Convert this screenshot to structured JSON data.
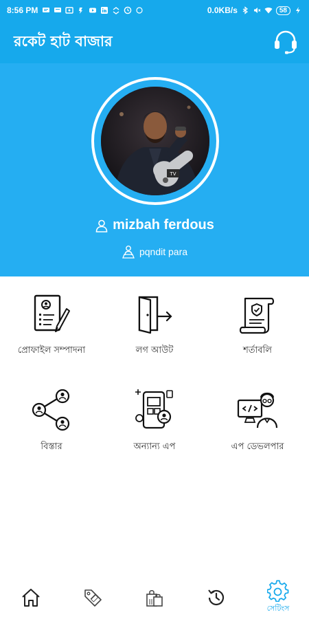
{
  "status_bar": {
    "time": "8:56 PM",
    "speed": "0.0KB/s",
    "battery": "58",
    "icons": [
      "chat-icon",
      "chat-icon",
      "message-icon",
      "signal-app-icon",
      "youtube-icon",
      "linkedin-icon",
      "transfer-icon",
      "clock-icon",
      "bluetooth-icon",
      "mute-icon",
      "wifi-icon",
      "battery-icon",
      "charging-icon"
    ]
  },
  "appbar": {
    "title": "রকেট হাট বাজার",
    "support_icon": "headset-icon"
  },
  "profile": {
    "name": "mizbah ferdous",
    "location": "pqndit para",
    "name_icon": "user-outline-icon",
    "location_icon": "location-pin-icon"
  },
  "menu": {
    "items": [
      {
        "label": "প্রোফাইল সম্পাদনা",
        "icon": "profile-edit-icon"
      },
      {
        "label": "লগ আউট",
        "icon": "logout-door-icon"
      },
      {
        "label": "শর্তাবলি",
        "icon": "terms-scroll-icon"
      },
      {
        "label": "বিস্তার",
        "icon": "share-network-icon"
      },
      {
        "label": "অন্যান্য এপ",
        "icon": "other-apps-icon"
      },
      {
        "label": "এপ ডেভলপার",
        "icon": "app-developer-icon"
      }
    ]
  },
  "bottom_nav": {
    "items": [
      {
        "icon": "home-icon",
        "label": ""
      },
      {
        "icon": "sale-tag-icon",
        "label": ""
      },
      {
        "icon": "shopping-bags-icon",
        "label": ""
      },
      {
        "icon": "history-icon",
        "label": ""
      },
      {
        "icon": "settings-gear-icon",
        "label": "সেটিংস"
      }
    ],
    "active_color": "#16a9ec"
  },
  "colors": {
    "primary": "#16a9ec",
    "header_bg": "#25aef2"
  }
}
